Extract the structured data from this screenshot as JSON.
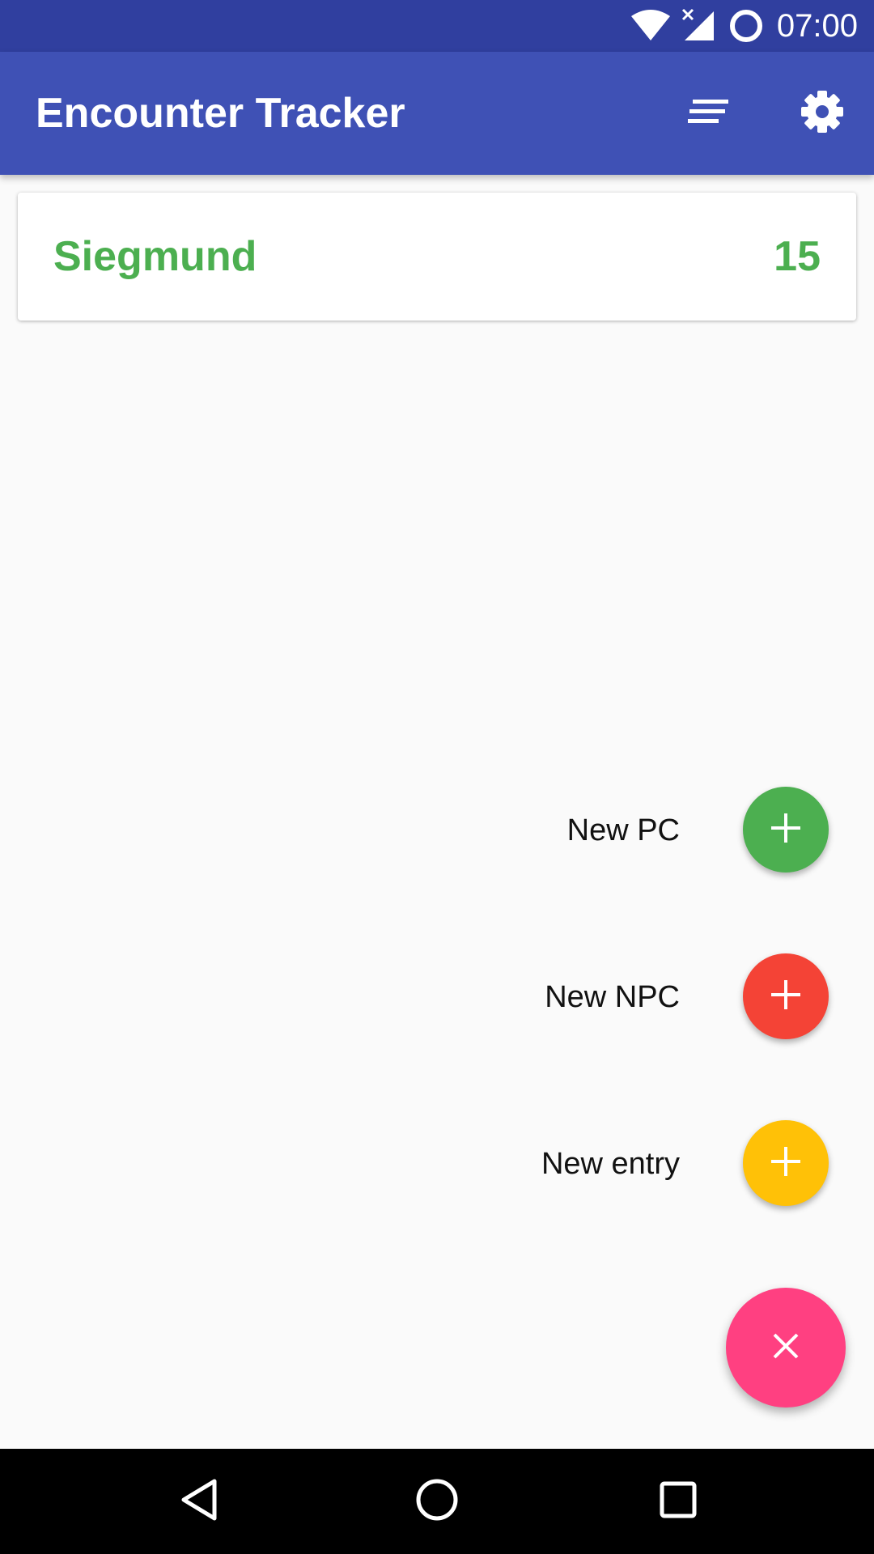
{
  "status_bar": {
    "time": "07:00",
    "icons": [
      "wifi-icon",
      "signal-icon",
      "circle-status-icon"
    ]
  },
  "app_bar": {
    "title": "Encounter Tracker",
    "actions": [
      "sort-icon",
      "settings-icon"
    ]
  },
  "entries": [
    {
      "name": "Siegmund",
      "value": "15"
    }
  ],
  "fab_menu": {
    "items": [
      {
        "label": "New PC",
        "icon": "plus-icon"
      },
      {
        "label": "New NPC",
        "icon": "plus-icon"
      },
      {
        "label": "New entry",
        "icon": "plus-icon"
      }
    ],
    "main_icon": "close-icon"
  },
  "nav_bar": {
    "buttons": [
      "back-icon",
      "home-icon",
      "recents-icon"
    ]
  },
  "colors": {
    "status_bar": "#303f9f",
    "app_bar": "#3f51b5",
    "pc_green": "#4caf50",
    "npc_red": "#f44336",
    "entry_amber": "#ffc107",
    "fab_pink": "#ff4081"
  }
}
